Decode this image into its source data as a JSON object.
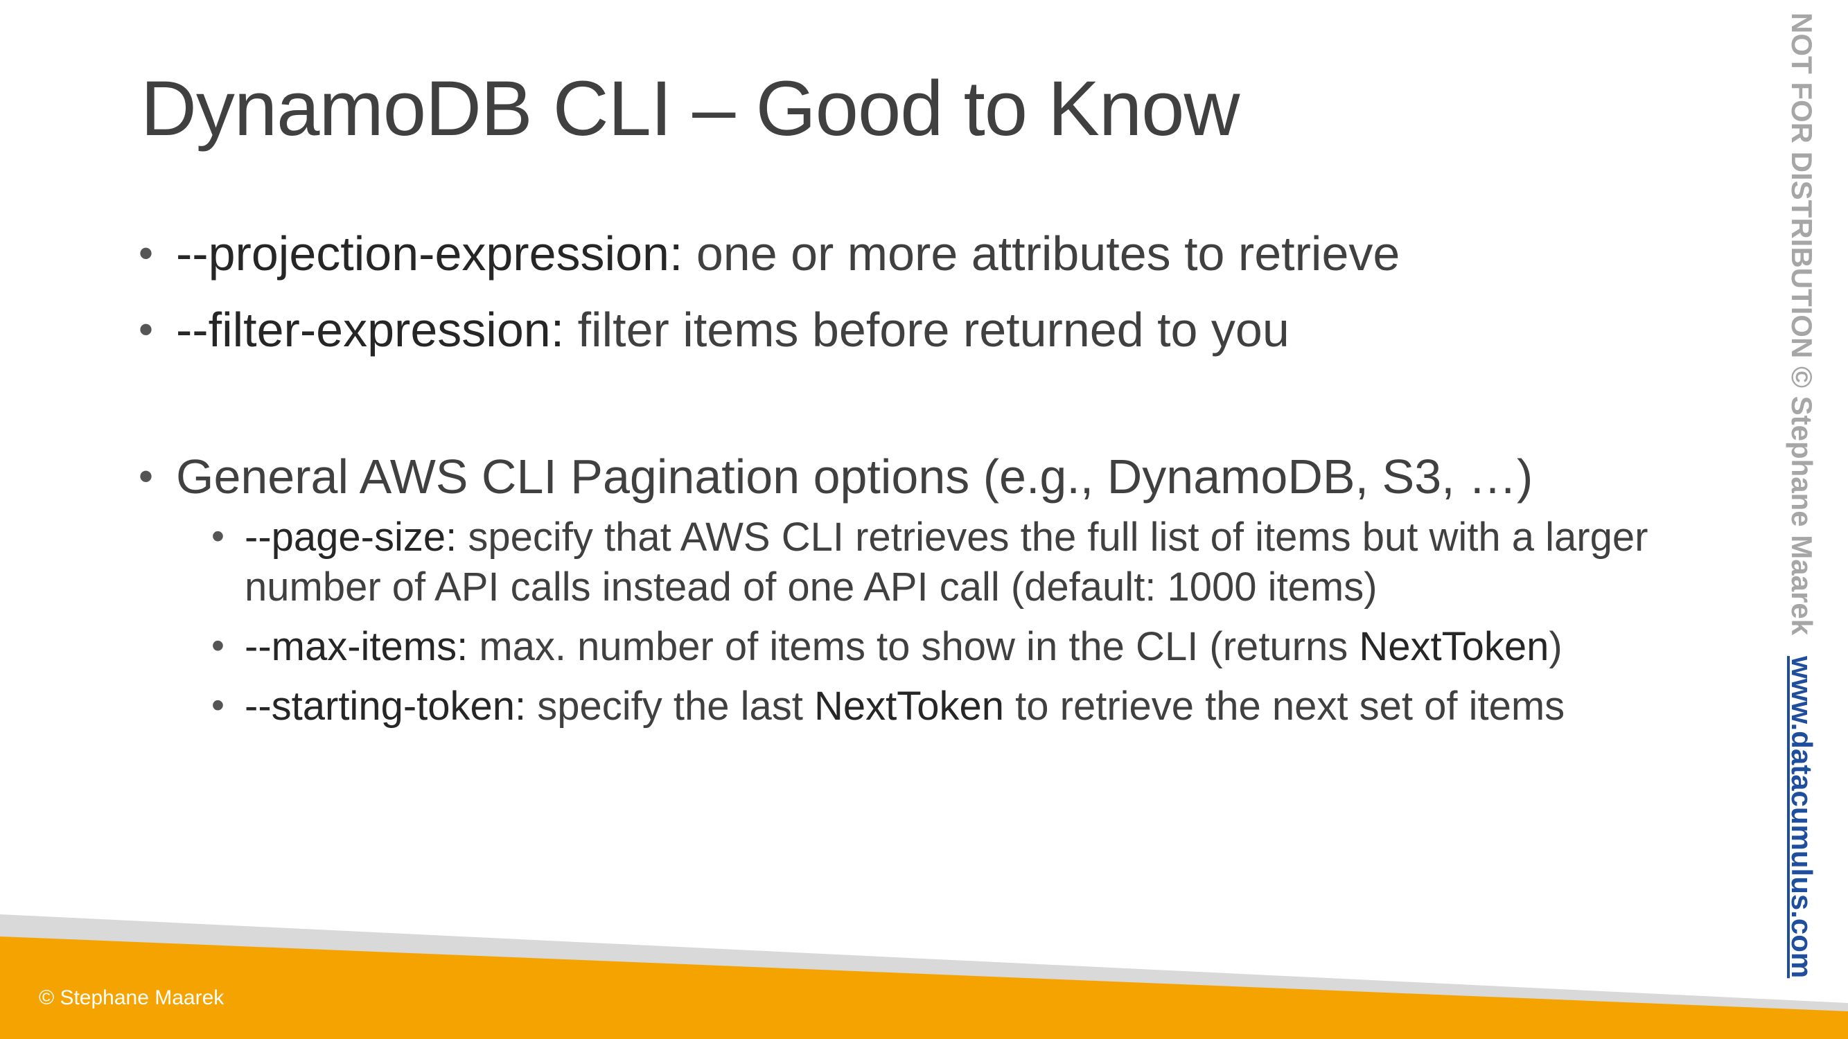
{
  "slide": {
    "title": "DynamoDB CLI – Good to Know",
    "bullets": [
      {
        "term": "--projection-expression:",
        "text": " one or more attributes to retrieve"
      },
      {
        "term": "--filter-expression:",
        "text": " filter items before returned to you"
      },
      {
        "text": "General AWS CLI Pagination options (e.g., DynamoDB, S3, …)"
      }
    ],
    "sub_bullets": [
      {
        "term": "--page-size:",
        "text": " specify that AWS CLI retrieves the full list of items but with a larger number of API calls instead of one API call (default: 1000 items)"
      },
      {
        "term": "--max-items:",
        "text_before": " max. number of items to show in the CLI (returns ",
        "strong": "NextToken",
        "text_after": ")"
      },
      {
        "term": "--starting-token:",
        "text_before": " specify the last ",
        "strong": "NextToken",
        "text_after": " to retrieve the next set of items"
      }
    ]
  },
  "side_banner": {
    "notice": "NOT FOR DISTRIBUTION © Stephane Maarek",
    "link": "www.datacumulus.com"
  },
  "footer": {
    "copyright": "© Stephane Maarek"
  },
  "colors": {
    "footer_orange": "#f5a300",
    "footer_gray": "#d9d9d9",
    "link_blue": "#1f4e9c",
    "notice_gray": "#a6a6a6"
  }
}
